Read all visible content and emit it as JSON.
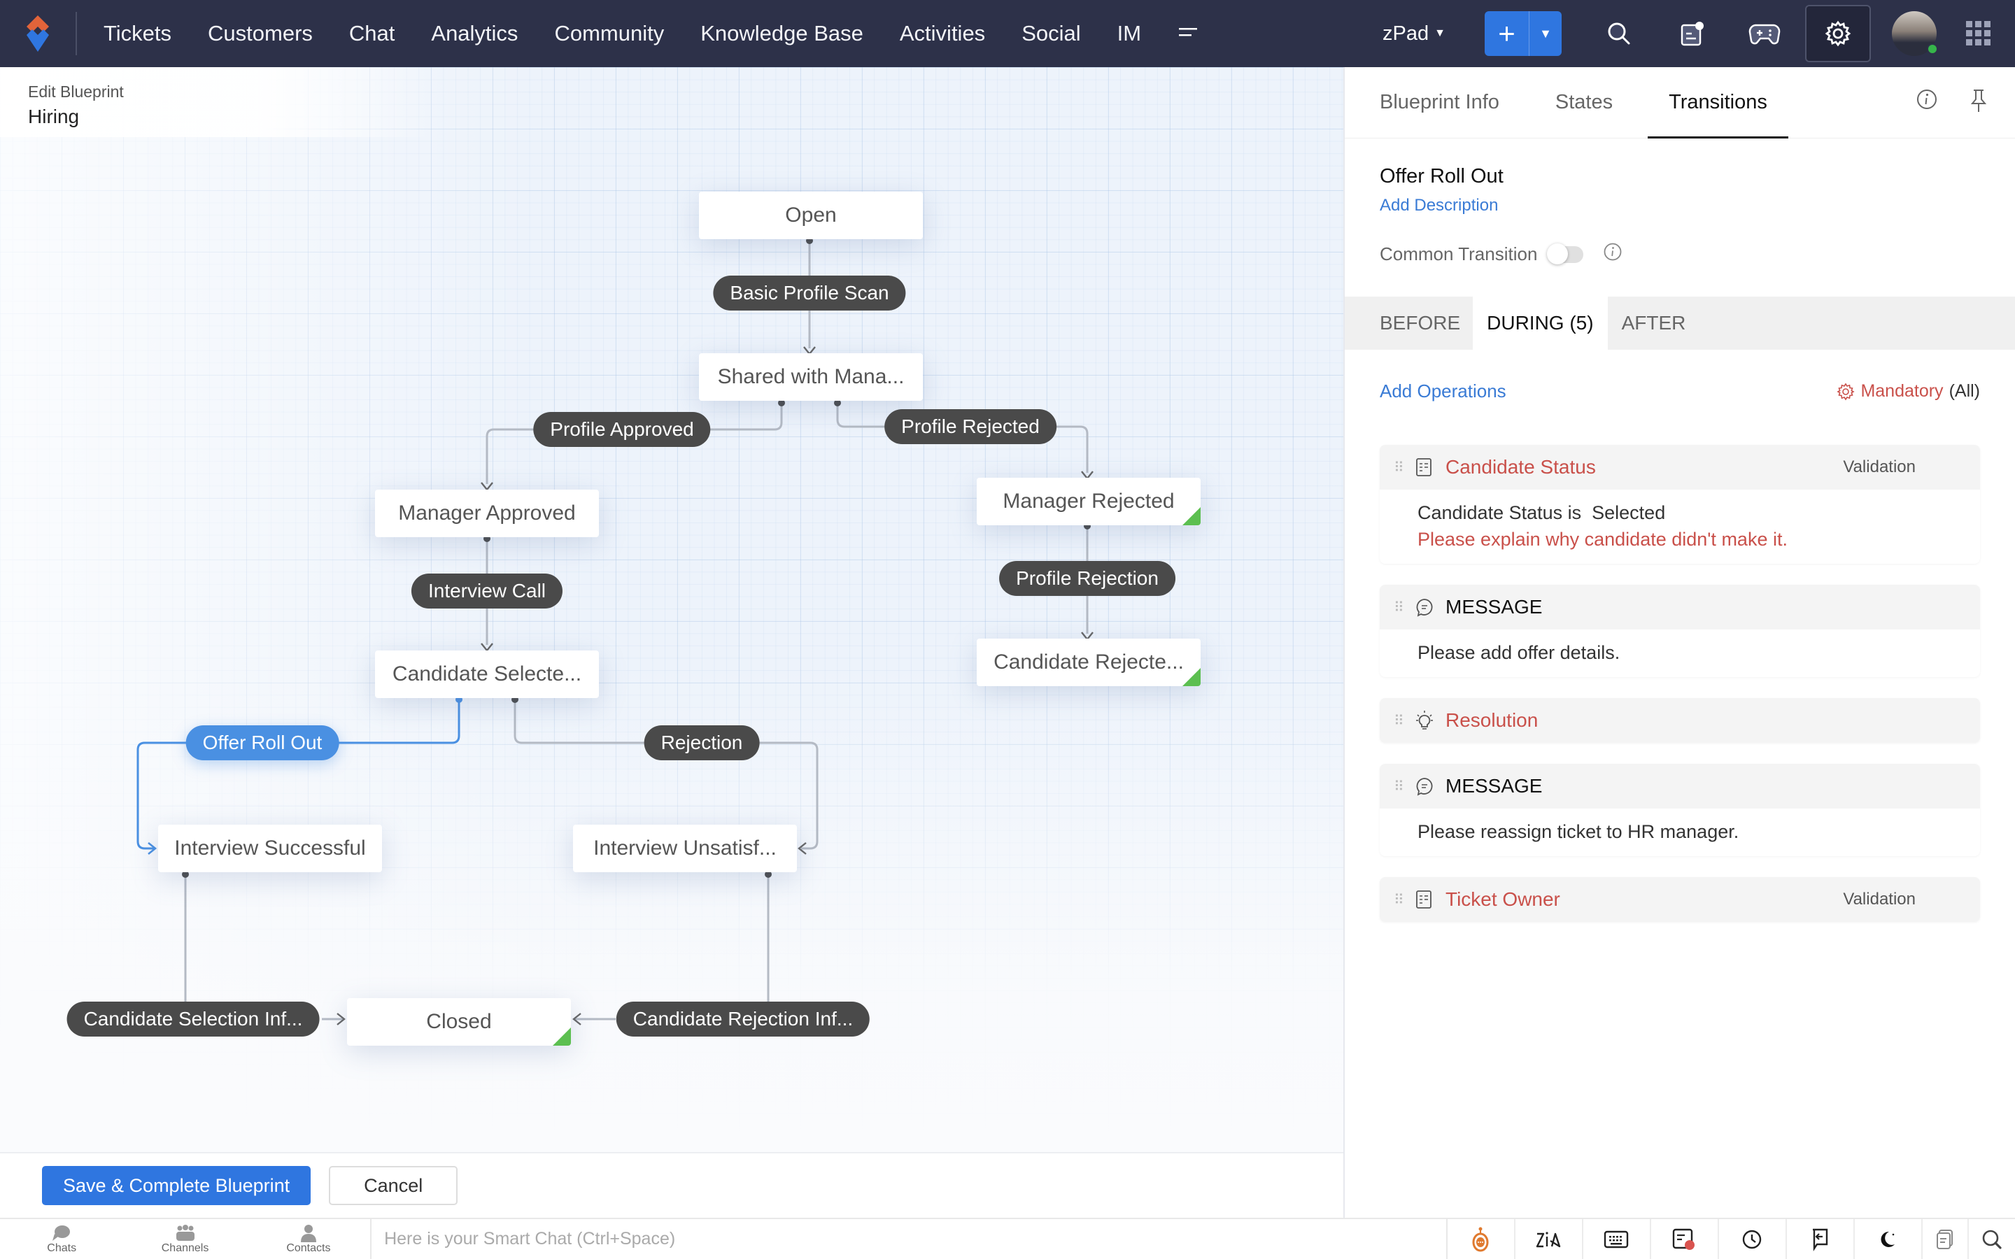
{
  "topbar": {
    "nav": [
      "Tickets",
      "Customers",
      "Chat",
      "Analytics",
      "Community",
      "Knowledge Base",
      "Activities",
      "Social",
      "IM"
    ],
    "portal": "zPad",
    "icons": [
      "search-icon",
      "notes-icon",
      "gamepad-icon",
      "settings-icon",
      "avatar",
      "apps-grid-icon"
    ]
  },
  "breadcrumb": {
    "label": "Edit Blueprint",
    "title": "Hiring"
  },
  "diagram": {
    "states": [
      {
        "id": "open",
        "label": "Open",
        "end": false
      },
      {
        "id": "shared",
        "label": "Shared with Mana...",
        "end": false
      },
      {
        "id": "mgr_approved",
        "label": "Manager Approved",
        "end": false
      },
      {
        "id": "mgr_rejected",
        "label": "Manager Rejected",
        "end": true
      },
      {
        "id": "cand_selected",
        "label": "Candidate Selecte...",
        "end": false
      },
      {
        "id": "cand_rejected",
        "label": "Candidate Rejecte...",
        "end": true
      },
      {
        "id": "int_success",
        "label": "Interview Successful",
        "end": false
      },
      {
        "id": "int_unsat",
        "label": "Interview Unsatisf...",
        "end": false
      },
      {
        "id": "closed",
        "label": "Closed",
        "end": true
      }
    ],
    "transitions": [
      {
        "id": "basic_scan",
        "label": "Basic Profile Scan",
        "from": "open",
        "to": "shared",
        "active": false
      },
      {
        "id": "profile_approved",
        "label": "Profile Approved",
        "from": "shared",
        "to": "mgr_approved",
        "active": false
      },
      {
        "id": "profile_rejected",
        "label": "Profile Rejected",
        "from": "shared",
        "to": "mgr_rejected",
        "active": false
      },
      {
        "id": "interview_call",
        "label": "Interview Call",
        "from": "mgr_approved",
        "to": "cand_selected",
        "active": false
      },
      {
        "id": "profile_rejection",
        "label": "Profile Rejection",
        "from": "mgr_rejected",
        "to": "cand_rejected",
        "active": false
      },
      {
        "id": "offer_roll_out",
        "label": "Offer Roll Out",
        "from": "cand_selected",
        "to": "int_success",
        "active": true
      },
      {
        "id": "rejection",
        "label": "Rejection",
        "from": "cand_selected",
        "to": "int_unsat",
        "active": false
      },
      {
        "id": "cand_sel_inf",
        "label": "Candidate Selection Inf...",
        "from": "int_success",
        "to": "closed",
        "active": false
      },
      {
        "id": "cand_rej_inf",
        "label": "Candidate Rejection Inf...",
        "from": "int_unsat",
        "to": "closed",
        "active": false
      }
    ]
  },
  "footer": {
    "save_label": "Save & Complete Blueprint",
    "cancel_label": "Cancel"
  },
  "panel": {
    "tabs": [
      {
        "label": "Blueprint Info",
        "active": false
      },
      {
        "label": "States",
        "active": false
      },
      {
        "label": "Transitions",
        "active": true
      }
    ],
    "transition_name": "Offer Roll Out",
    "add_description": "Add Description",
    "common_transition_label": "Common Transition",
    "common_transition_on": false,
    "phases": [
      {
        "label": "BEFORE",
        "active": false
      },
      {
        "label": "DURING (5)",
        "active": true
      },
      {
        "label": "AFTER",
        "active": false
      }
    ],
    "add_operations": "Add Operations",
    "mandatory_label": "Mandatory",
    "mandatory_scope": "(All)",
    "operations": [
      {
        "icon": "field-icon",
        "title": "Candidate Status",
        "title_color": "red",
        "tag": "Validation",
        "body": [
          "Candidate Status is  Selected"
        ],
        "error": "Please explain why candidate didn't make it."
      },
      {
        "icon": "message-icon",
        "title": "MESSAGE",
        "title_color": "dark",
        "tag": "",
        "body": [
          "Please add offer details."
        ],
        "error": ""
      },
      {
        "icon": "bulb-icon",
        "title": "Resolution",
        "title_color": "red",
        "tag": "",
        "body": [],
        "error": ""
      },
      {
        "icon": "message-icon",
        "title": "MESSAGE",
        "title_color": "dark",
        "tag": "",
        "body": [
          "Please reassign ticket to HR manager."
        ],
        "error": ""
      },
      {
        "icon": "field-icon",
        "title": "Ticket Owner",
        "title_color": "red",
        "tag": "Validation",
        "body": [],
        "error": ""
      }
    ]
  },
  "bottombar": {
    "items": [
      {
        "label": "Chats",
        "icon": "chat-bubbles-icon"
      },
      {
        "label": "Channels",
        "icon": "channels-icon"
      },
      {
        "label": "Contacts",
        "icon": "contact-icon"
      }
    ],
    "smart_chat_placeholder": "Here is your Smart Chat (Ctrl+Space)",
    "tools": [
      "bot-icon",
      "zia-icon",
      "keyboard-icon",
      "notes-alert-icon",
      "clock-icon",
      "reply-icon",
      "moon-icon",
      "documents-icon",
      "search-icon"
    ]
  },
  "colors": {
    "topbar": "#2d3149",
    "primary": "#2f76e0",
    "pill": "#4a4a4a",
    "active_pill": "#4a90e2",
    "end_state": "#5cbf50",
    "error": "#c9504a"
  }
}
